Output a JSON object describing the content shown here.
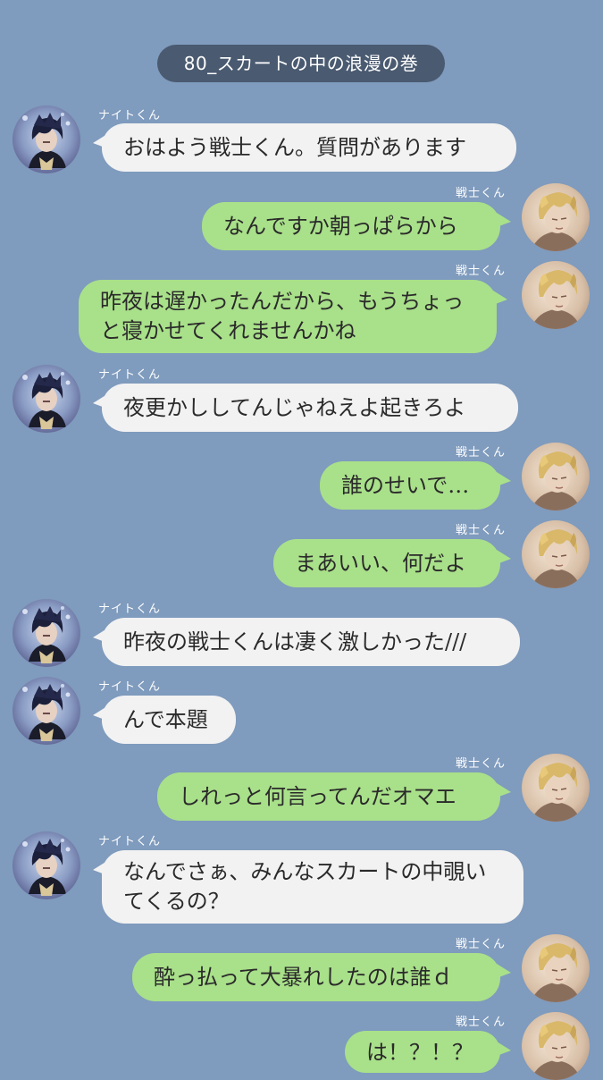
{
  "header": {
    "title": "80_スカートの中の浪漫の巻"
  },
  "senders": {
    "knight": "ナイトくん",
    "warrior": "戦士くん"
  },
  "messages": [
    {
      "from": "knight",
      "text": "おはよう戦士くん。質問があります"
    },
    {
      "from": "warrior",
      "text": "なんですか朝っぱらから"
    },
    {
      "from": "warrior",
      "text": "昨夜は遅かったんだから、もうちょっと寝かせてくれませんかね"
    },
    {
      "from": "knight",
      "text": "夜更かししてんじゃねえよ起きろよ"
    },
    {
      "from": "warrior",
      "text": "誰のせいで…"
    },
    {
      "from": "warrior",
      "text": "まあいい、何だよ"
    },
    {
      "from": "knight",
      "text": "昨夜の戦士くんは凄く激しかった///"
    },
    {
      "from": "knight",
      "text": "んで本題"
    },
    {
      "from": "warrior",
      "text": "しれっと何言ってんだオマエ"
    },
    {
      "from": "knight",
      "text": "なんでさぁ、みんなスカートの中覗いてくるの？"
    },
    {
      "from": "warrior",
      "text": "酔っ払って大暴れしたのは誰ｄ"
    },
    {
      "from": "warrior",
      "text": "は！？！？"
    }
  ],
  "colors": {
    "background": "#7f9bbd",
    "left_bubble": "#f2f2f2",
    "right_bubble": "#a9e08a",
    "title_pill": "#4a5a70"
  }
}
